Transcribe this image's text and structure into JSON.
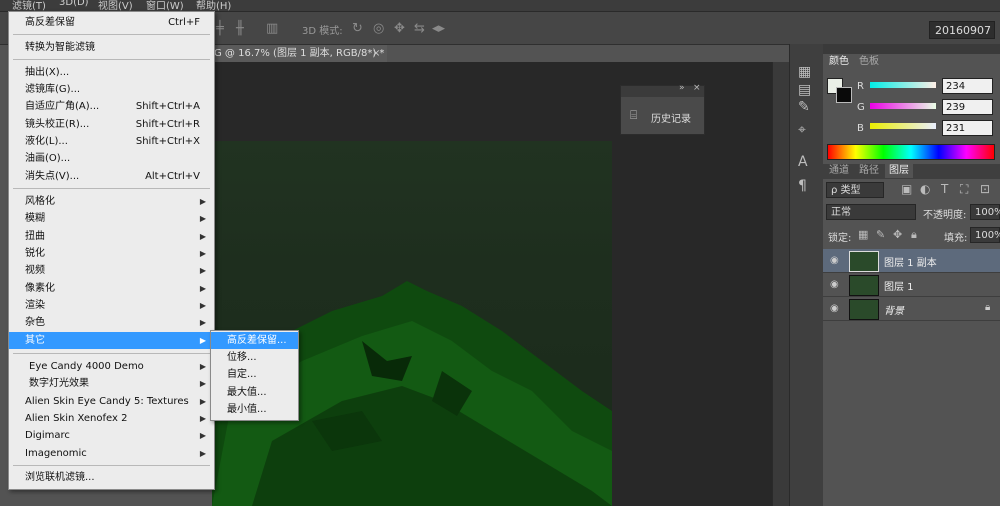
{
  "menubar": {
    "items": [
      "滤镜(T)",
      "3D(D)",
      "视图(V)",
      "窗口(W)",
      "帮助(H)"
    ]
  },
  "options_bar": {
    "mode_label": "3D 模式:",
    "workspace": "20160907"
  },
  "document": {
    "tab_title": "G @ 16.7% (图层 1 副本, RGB/8*) *",
    "close_glyph": "×"
  },
  "history_panel": {
    "title": "历史记录"
  },
  "filter_menu": {
    "items": [
      {
        "label": "高反差保留",
        "shortcut": "Ctrl+F"
      },
      {
        "label": "转换为智能滤镜"
      },
      {
        "label": "抽出(X)..."
      },
      {
        "label": "滤镜库(G)..."
      },
      {
        "label": "自适应广角(A)...",
        "shortcut": "Shift+Ctrl+A"
      },
      {
        "label": "镜头校正(R)...",
        "shortcut": "Shift+Ctrl+R"
      },
      {
        "label": "液化(L)...",
        "shortcut": "Shift+Ctrl+X"
      },
      {
        "label": "油画(O)..."
      },
      {
        "label": "消失点(V)...",
        "shortcut": "Alt+Ctrl+V"
      },
      {
        "label": "风格化"
      },
      {
        "label": "模糊"
      },
      {
        "label": "扭曲"
      },
      {
        "label": "锐化"
      },
      {
        "label": "视频"
      },
      {
        "label": "像素化"
      },
      {
        "label": "渲染"
      },
      {
        "label": "杂色"
      },
      {
        "label": "其它"
      },
      {
        "label": "Eye Candy 4000  Demo"
      },
      {
        "label": "数字灯光效果"
      },
      {
        "label": "Alien Skin Eye Candy 5: Textures"
      },
      {
        "label": "Alien Skin Xenofex 2"
      },
      {
        "label": "Digimarc"
      },
      {
        "label": "Imagenomic"
      },
      {
        "label": "浏览联机滤镜..."
      }
    ]
  },
  "other_submenu": {
    "items": [
      "高反差保留...",
      "位移...",
      "自定...",
      "最大值...",
      "最小值..."
    ]
  },
  "color_panel": {
    "tabs": [
      "颜色",
      "色板"
    ],
    "r_label": "R",
    "r_value": "234",
    "g_label": "G",
    "g_value": "239",
    "b_label": "B",
    "b_value": "231",
    "accent": "#3399ff"
  },
  "layers_panel": {
    "tabs": [
      "通道",
      "路径",
      "图层"
    ],
    "filter_kind": "ρ 类型",
    "blend_mode": "正常",
    "opacity_label": "不透明度:",
    "opacity_value": "100%",
    "lock_label": "锁定:",
    "fill_label": "填充:",
    "fill_value": "100%",
    "layers": [
      {
        "name": "图层 1 副本",
        "selected": true
      },
      {
        "name": "图层 1",
        "selected": false
      },
      {
        "name": "背景",
        "selected": false,
        "locked": true
      }
    ]
  }
}
